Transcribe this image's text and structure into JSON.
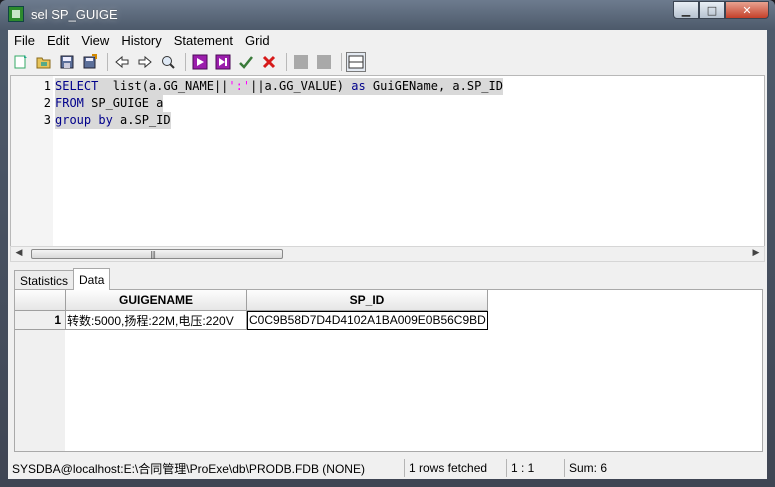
{
  "window": {
    "title": "sel SP_GUIGE",
    "minimize": "▁",
    "maximize": "□",
    "close": "✕"
  },
  "menu": [
    "File",
    "Edit",
    "View",
    "History",
    "Statement",
    "Grid"
  ],
  "toolbar": {
    "icons": [
      "new-icon",
      "open-icon",
      "save-icon",
      "save-all-icon",
      "back-icon",
      "forward-icon",
      "find-icon",
      "run-icon",
      "run-step-icon",
      "commit-icon",
      "rollback-icon",
      "disabled-icon-1",
      "disabled-icon-2",
      "layout-icon"
    ],
    "accent": "#9b1dac"
  },
  "editor": {
    "line_numbers": [
      "1",
      "2",
      "3"
    ],
    "lines": [
      [
        {
          "t": "SELECT",
          "c": "kw"
        },
        {
          "t": "  list(a.GG_NAME||",
          "c": ""
        },
        {
          "t": "':'",
          "c": "str"
        },
        {
          "t": "||a.GG_VALUE) ",
          "c": ""
        },
        {
          "t": "as",
          "c": "kw"
        },
        {
          "t": " GuiGEName, a.SP_ID",
          "c": ""
        }
      ],
      [
        {
          "t": "FROM",
          "c": "kw"
        },
        {
          "t": " SP_GUIGE a",
          "c": ""
        }
      ],
      [
        {
          "t": "group by",
          "c": "kw"
        },
        {
          "t": " a.SP_ID",
          "c": ""
        }
      ]
    ]
  },
  "scrollbar": {
    "left": "◀",
    "right": "▶",
    "grip": "|||"
  },
  "tabs": [
    {
      "label": "Statistics",
      "active": false
    },
    {
      "label": "Data",
      "active": true
    }
  ],
  "grid": {
    "columns": [
      "GUIGENAME",
      "SP_ID"
    ],
    "rows": [
      {
        "num": "1",
        "cells": [
          "转数:5000,扬程:22M,电压:220V",
          "C0C9B58D7D4D4102A1BA009E0B56C9BD"
        ]
      }
    ]
  },
  "status": {
    "connection": "SYSDBA@localhost:E:\\合同管理\\ProExe\\db\\PRODB.FDB (NONE)",
    "fetched": "1 rows fetched",
    "position": "1 : 1",
    "sum": "Sum: 6"
  }
}
